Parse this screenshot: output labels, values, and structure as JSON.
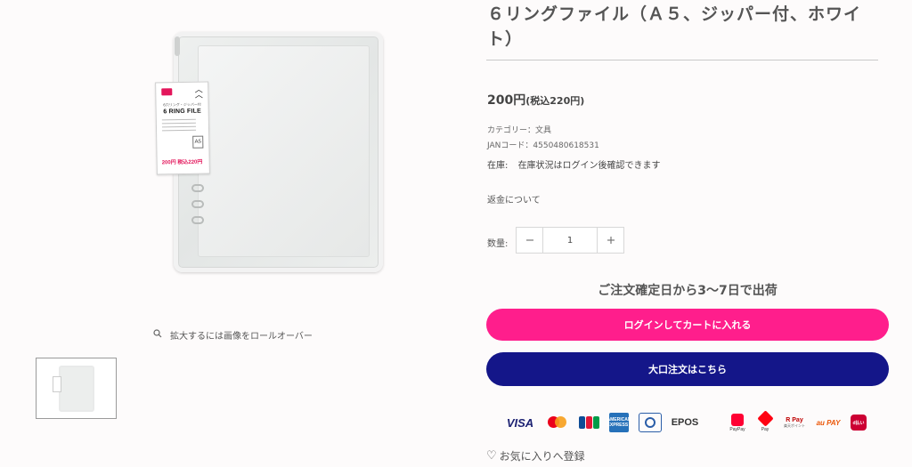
{
  "product": {
    "title": "６リングファイル（Ａ５、ジッパー付、ホワイト）",
    "price_main": "200円",
    "price_tax": "(税込220円)",
    "category": "カテゴリー：文具",
    "jan": "JANコード：4550480618531",
    "stock_label": "在庫:",
    "stock_value": "在庫状況はログイン後確認できます",
    "refund_link": "返金について",
    "quantity_label": "数量:",
    "quantity_value": "1",
    "shipping_note": "ご注文確定日から3〜7日で出荷"
  },
  "gallery": {
    "zoom_hint": "拡大するには画像をロールオーバー",
    "tag_title": "6 RING FILE",
    "tag_subtitle": "6穴リング・ジッパー付",
    "tag_size": "A5",
    "tag_price": "200円 税込220円"
  },
  "actions": {
    "login_cart": "ログインしてカートに入れる",
    "bulk_order": "大口注文はこちら",
    "favorite": "お気に入りへ登録"
  },
  "payments": {
    "visa": "VISA",
    "amex": "AMERICAN EXPRESS",
    "epos": "EPOS",
    "paypay": "PayPay",
    "merpay": "Pay",
    "rpay": "R Pay",
    "aupay": "au PAY",
    "dpay": "d払い"
  },
  "colors": {
    "login_button": "#ff1e8c",
    "bulk_button": "#141689",
    "title_text": "#555555"
  }
}
